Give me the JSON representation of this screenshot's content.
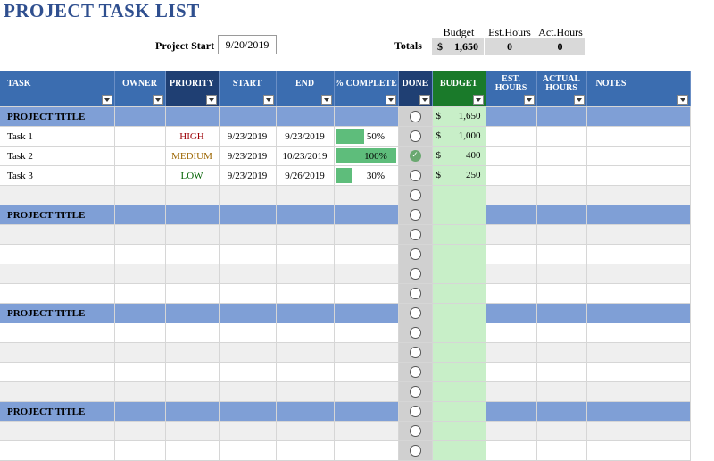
{
  "title": "PROJECT TASK LIST",
  "project_start": {
    "label": "Project Start",
    "value": "9/20/2019"
  },
  "totals": {
    "label": "Totals",
    "budget_label": "Budget",
    "est_label": "Est.Hours",
    "act_label": "Act.Hours",
    "currency": "$",
    "budget_value": "1,650",
    "est_value": "0",
    "act_value": "0"
  },
  "columns": {
    "task": "TASK",
    "owner": "OWNER",
    "priority": "PRIORITY",
    "start": "START",
    "end": "END",
    "complete": "% COMPLETE",
    "done": "DONE",
    "budget": "BUDGET",
    "est": "EST. HOURS",
    "actual": "ACTUAL HOURS",
    "notes": "NOTES"
  },
  "section_title": "PROJECT TITLE",
  "section1_budget": "1,650",
  "tasks": [
    {
      "name": "Task 1",
      "priority": "HIGH",
      "start": "9/23/2019",
      "end": "9/23/2019",
      "complete": "50%",
      "complete_pct": 50,
      "done": false,
      "budget": "1,000"
    },
    {
      "name": "Task 2",
      "priority": "MEDIUM",
      "start": "9/23/2019",
      "end": "10/23/2019",
      "complete": "100%",
      "complete_pct": 100,
      "done": true,
      "budget": "400"
    },
    {
      "name": "Task 3",
      "priority": "LOW",
      "start": "9/23/2019",
      "end": "9/26/2019",
      "complete": "30%",
      "complete_pct": 30,
      "done": false,
      "budget": "250"
    }
  ],
  "colors": {
    "header": "#3b6db0",
    "section": "#7f9fd6",
    "budget": "#1a7a2a",
    "title": "#2F4F8F"
  }
}
